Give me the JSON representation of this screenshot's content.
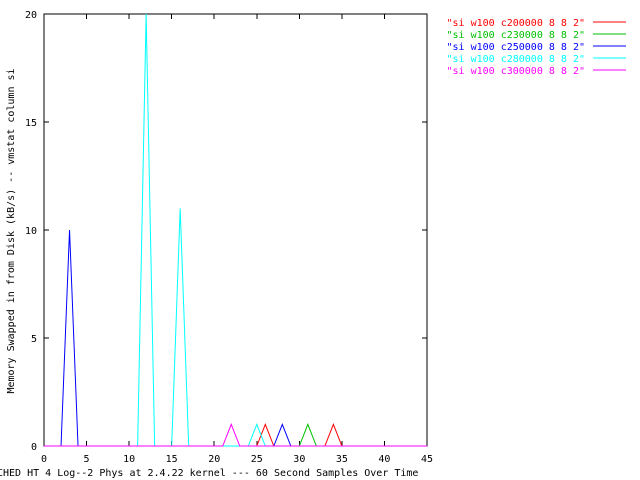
{
  "chart_data": {
    "type": "line",
    "title": "",
    "xlabel": "CHED HT 4 Log--2 Phys at 2.4.22 kernel --- 60 Second Samples Over Time",
    "ylabel": "Memory Swapped in from Disk (kB/s) -- vmstat column si",
    "xlim": [
      0,
      45
    ],
    "ylim": [
      0,
      20
    ],
    "xticks": [
      0,
      5,
      10,
      15,
      20,
      25,
      30,
      35,
      40,
      45
    ],
    "yticks": [
      0,
      5,
      10,
      15,
      20
    ],
    "x": [
      0,
      1,
      2,
      3,
      4,
      5,
      6,
      7,
      8,
      9,
      10,
      11,
      12,
      13,
      14,
      15,
      16,
      17,
      18,
      19,
      20,
      21,
      22,
      23,
      24,
      25,
      26,
      27,
      28,
      29,
      30,
      31,
      32,
      33,
      34,
      35,
      36,
      37,
      38,
      39,
      40,
      41,
      42,
      43,
      44,
      45
    ],
    "legend_position": "top-right, outside plot",
    "grid": false,
    "series": [
      {
        "name": "\"si w100 c200000 8 8 2\"",
        "color": "#ff0000",
        "values": [
          0,
          0,
          0,
          0,
          0,
          0,
          0,
          0,
          0,
          0,
          0,
          0,
          0,
          0,
          0,
          0,
          0,
          0,
          0,
          0,
          0,
          0,
          0,
          0,
          0,
          0,
          1,
          0,
          0,
          0,
          0,
          0,
          0,
          0,
          1,
          0,
          0,
          0,
          0,
          0,
          0,
          0,
          0,
          0,
          0,
          0
        ]
      },
      {
        "name": "\"si w100 c230000 8 8 2\"",
        "color": "#00c000",
        "values": [
          0,
          0,
          0,
          0,
          0,
          0,
          0,
          0,
          0,
          0,
          0,
          0,
          0,
          0,
          0,
          0,
          0,
          0,
          0,
          0,
          0,
          0,
          0,
          0,
          0,
          0,
          0,
          0,
          0,
          0,
          0,
          1,
          0,
          0,
          0,
          0,
          0,
          0,
          0,
          0,
          0,
          0,
          0,
          0,
          0,
          0
        ]
      },
      {
        "name": "\"si w100 c250000 8 8 2\"",
        "color": "#0000ff",
        "values": [
          0,
          0,
          0,
          10,
          0,
          0,
          0,
          0,
          0,
          0,
          0,
          0,
          0,
          0,
          0,
          0,
          0,
          0,
          0,
          0,
          0,
          0,
          0,
          0,
          0,
          0,
          0,
          0,
          1,
          0,
          0,
          0,
          0,
          0,
          0,
          0,
          0,
          0,
          0,
          0,
          0,
          0,
          0,
          0,
          0,
          0
        ]
      },
      {
        "name": "\"si w100 c280000 8 8 2\"",
        "color": "#00ffff",
        "values": [
          0,
          0,
          0,
          0,
          0,
          0,
          0,
          0,
          0,
          0,
          0,
          0,
          20,
          0,
          0,
          0,
          11,
          0,
          0,
          0,
          0,
          0,
          0,
          0,
          0,
          1,
          0,
          0,
          0,
          0,
          0,
          0,
          0,
          0,
          0,
          0,
          0,
          0,
          0,
          0,
          0,
          0,
          0,
          0,
          0,
          0
        ]
      },
      {
        "name": "\"si w100 c300000 8 8 2\"",
        "color": "#ff00ff",
        "values": [
          0,
          0,
          0,
          0,
          0,
          0,
          0,
          0,
          0,
          0,
          0,
          0,
          0,
          0,
          0,
          0,
          0,
          0,
          0,
          0,
          0,
          0,
          1,
          0,
          0,
          0,
          0,
          0,
          0,
          0,
          0,
          0,
          0,
          0,
          0,
          0,
          0,
          0,
          0,
          0,
          0,
          0,
          0,
          0,
          0,
          0
        ]
      }
    ]
  }
}
